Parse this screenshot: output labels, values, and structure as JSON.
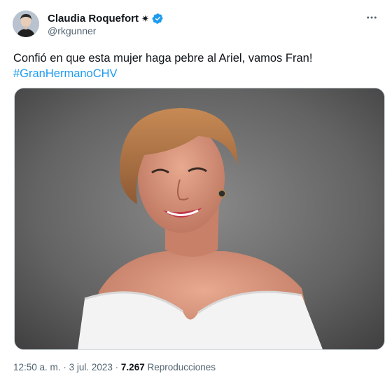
{
  "author": {
    "display_name": "Claudia Roquefort",
    "badge_symbol": "✷",
    "handle": "@rkgunner",
    "verified_color": "#1d9bf0"
  },
  "tweet": {
    "text": "Confió en que esta mujer haga pebre al Ariel, vamos Fran!",
    "hashtag": "#GranHermanoCHV"
  },
  "meta": {
    "time": "12:50 a. m.",
    "separator": "·",
    "date": "3 jul. 2023",
    "views_count": "7.267",
    "views_label": "Reproducciones"
  },
  "colors": {
    "link": "#1d9bf0",
    "secondary_text": "#536471",
    "primary_text": "#0f1419"
  },
  "icons": {
    "more": "more-horizontal-icon",
    "verified": "verified-badge-icon"
  }
}
